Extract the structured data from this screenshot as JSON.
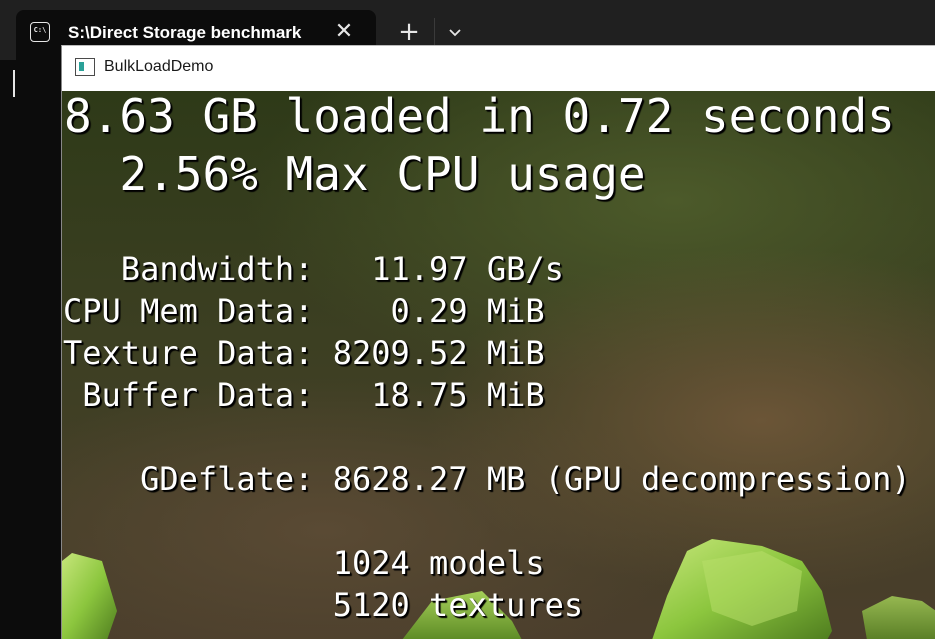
{
  "terminal": {
    "tab_title": "S:\\Direct Storage benchmark",
    "tab_icon_glyph": "C:\\",
    "close_glyph": "✕",
    "new_tab_glyph": "+",
    "icons": [
      "terminal-icon",
      "close-icon",
      "plus-icon",
      "chevron-down-icon"
    ]
  },
  "window": {
    "title": "BulkLoadDemo",
    "icon": "app-window-icon"
  },
  "stats": {
    "headline": "8.63 GB loaded in 0.72 seconds",
    "cpu_usage": "  2.56% Max CPU usage",
    "bandwidth": "   Bandwidth:   11.97 GB/s",
    "cpu_mem": "CPU Mem Data:    0.29 MiB",
    "texture": "Texture Data: 8209.52 MiB",
    "buffer": " Buffer Data:   18.75 MiB",
    "gdeflate": "    GDeflate: 8628.27 MB (GPU decompression)",
    "models": "              1024 models",
    "textures": "              5120 textures"
  },
  "colors": {
    "terminal_bg": "#0c0c0c",
    "tabstrip_bg": "#202020",
    "text": "#ffffff",
    "leaf_green": "#8cc63e"
  }
}
